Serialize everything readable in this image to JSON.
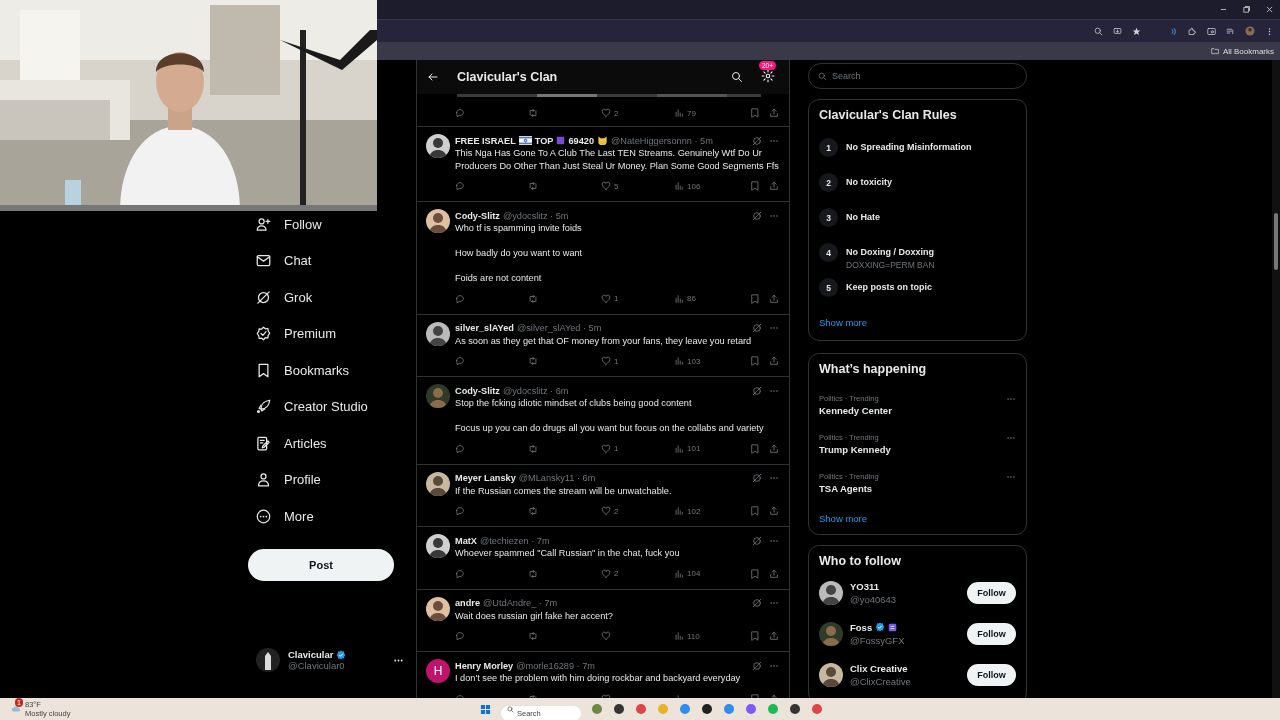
{
  "browser": {
    "bookmarks_label": "All Bookmarks"
  },
  "nav": {
    "items": [
      {
        "label": "Follow",
        "selected": false
      },
      {
        "label": "Chat",
        "selected": false
      },
      {
        "label": "Grok",
        "selected": false
      },
      {
        "label": "Premium",
        "selected": false
      },
      {
        "label": "Bookmarks",
        "selected": false
      },
      {
        "label": "Creator Studio",
        "selected": false
      },
      {
        "label": "Articles",
        "selected": false
      },
      {
        "label": "Profile",
        "selected": false
      },
      {
        "label": "More",
        "selected": false
      }
    ],
    "post_button": "Post",
    "account": {
      "name": "Clavicular",
      "verified": true,
      "handle": "@Clavicular0"
    }
  },
  "feed": {
    "title": "Clavicular's Clan",
    "badge": "20+",
    "posts": [
      {
        "kind": "actions",
        "likes": "2",
        "views": "79"
      },
      {
        "kind": "post",
        "name_parts": [
          {
            "kind": "text",
            "text": "FREE ISRAEL"
          },
          {
            "kind": "flag"
          },
          {
            "kind": "text",
            "text": "TOP"
          },
          {
            "kind": "square"
          },
          {
            "kind": "text",
            "text": "69420"
          },
          {
            "kind": "cat"
          }
        ],
        "meta": "@NateHiggersonnn · 5m",
        "paragraphs": [
          "This Nga Has Gone To A Club The Last TEN Streams. Genuinely Wtf Do Ur Producers Do Other Than Just Steal Ur Money. Plan Some Good Segments Ffs"
        ],
        "likes": "5",
        "views": "106"
      },
      {
        "kind": "post",
        "name": "Cody-Slitz",
        "meta": "@ydocslitz · 5m",
        "paragraphs": [
          "Who tf is spamming invite foids",
          "How badly do you want to want",
          "Foids are not content"
        ],
        "likes": "1",
        "views": "86"
      },
      {
        "kind": "post",
        "name": "silver_slAYed",
        "meta": "@silver_slAYed · 5m",
        "paragraphs": [
          "As soon as they get that OF money from your fans, they leave you retard"
        ],
        "likes": "1",
        "views": "103"
      },
      {
        "kind": "post",
        "name": "Cody-Slitz",
        "meta": "@ydocslitz · 6m",
        "paragraphs": [
          "Stop the fcking idiotic mindset of clubs being good content",
          "Focus up you can do drugs all you want but focus on the collabs and variety"
        ],
        "likes": "1",
        "views": "101"
      },
      {
        "kind": "post",
        "name": "Meyer Lansky",
        "meta": "@MLansky11 · 6m",
        "paragraphs": [
          "If the Russian comes the stream will be unwatchable."
        ],
        "likes": "2",
        "views": "102"
      },
      {
        "kind": "post",
        "name": "MatX",
        "meta": "@techiezen · 7m",
        "paragraphs": [
          "Whoever spammed \"Call Russian\" in the chat, fuck you"
        ],
        "likes": "2",
        "views": "104"
      },
      {
        "kind": "post",
        "name": "andre",
        "meta": "@UtdAndre_ · 7m",
        "paragraphs": [
          "Wait does russian girl fake her accent?"
        ],
        "views": "110"
      },
      {
        "kind": "post",
        "name": "Henry Morley",
        "avatar_letter": "H",
        "meta": "@morle16289 · 7m",
        "paragraphs": [
          "I don't see the problem with him doing rockbar and backyard everyday"
        ]
      }
    ]
  },
  "sidebar": {
    "search": {
      "placeholder": "Search"
    },
    "rules": {
      "title": "Clavicular's Clan Rules",
      "items": [
        {
          "number": "1",
          "title": "No Spreading Misinformation"
        },
        {
          "number": "2",
          "title": "No toxicity"
        },
        {
          "number": "3",
          "title": "No Hate"
        },
        {
          "number": "4",
          "title": "No Doxing / Doxxing",
          "detail": "DOXXING=PERM BAN"
        },
        {
          "number": "5",
          "title": "Keep posts on topic"
        }
      ],
      "show_more": "Show more"
    },
    "trends": {
      "title": "What’s happening",
      "items": [
        {
          "category": "Politics · Trending",
          "name": "Kennedy Center"
        },
        {
          "category": "Politics · Trending",
          "name": "Trump Kennedy"
        },
        {
          "category": "Politics · Trending",
          "name": "TSA Agents"
        }
      ],
      "show_more": "Show more"
    },
    "who_to_follow": {
      "title": "Who to follow",
      "accounts": [
        {
          "name": "YO311",
          "handle": "@yo40643",
          "verified": false,
          "subscriber": false,
          "button": "Follow"
        },
        {
          "name": "Foss",
          "handle": "@FossyGFX",
          "verified": true,
          "subscriber": true,
          "button": "Follow"
        },
        {
          "name": "Clix Creative",
          "handle": "@ClixCreative",
          "verified": false,
          "subscriber": false,
          "button": "Follow"
        }
      ]
    }
  },
  "taskbar": {
    "weather": {
      "alerts": "1",
      "temperature": "83°F",
      "condition": "Mostly cloudy"
    },
    "search": {
      "placeholder": "Search"
    }
  }
}
